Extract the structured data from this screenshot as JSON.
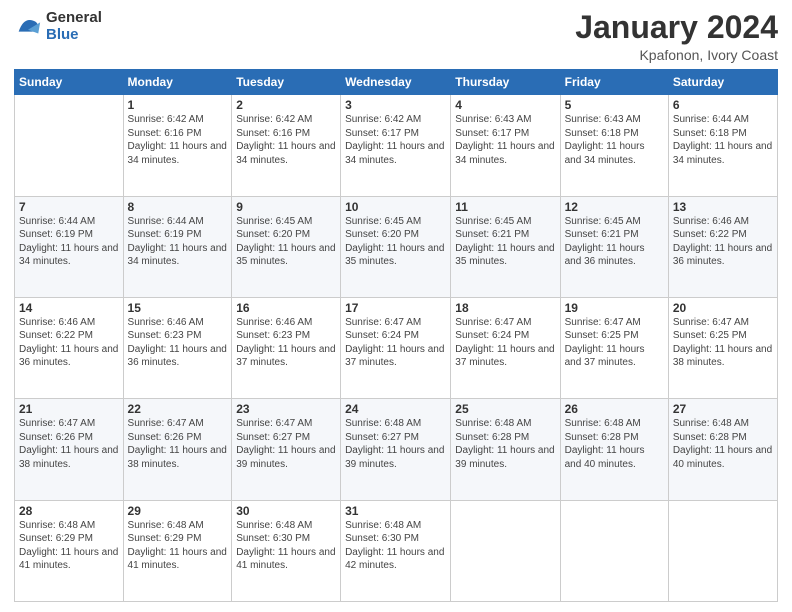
{
  "logo": {
    "general": "General",
    "blue": "Blue"
  },
  "header": {
    "title": "January 2024",
    "subtitle": "Kpafonon, Ivory Coast"
  },
  "days_of_week": [
    "Sunday",
    "Monday",
    "Tuesday",
    "Wednesday",
    "Thursday",
    "Friday",
    "Saturday"
  ],
  "weeks": [
    [
      {
        "day": "",
        "info": ""
      },
      {
        "day": "1",
        "info": "Sunrise: 6:42 AM\nSunset: 6:16 PM\nDaylight: 11 hours and 34 minutes."
      },
      {
        "day": "2",
        "info": "Sunrise: 6:42 AM\nSunset: 6:16 PM\nDaylight: 11 hours and 34 minutes."
      },
      {
        "day": "3",
        "info": "Sunrise: 6:42 AM\nSunset: 6:17 PM\nDaylight: 11 hours and 34 minutes."
      },
      {
        "day": "4",
        "info": "Sunrise: 6:43 AM\nSunset: 6:17 PM\nDaylight: 11 hours and 34 minutes."
      },
      {
        "day": "5",
        "info": "Sunrise: 6:43 AM\nSunset: 6:18 PM\nDaylight: 11 hours and 34 minutes."
      },
      {
        "day": "6",
        "info": "Sunrise: 6:44 AM\nSunset: 6:18 PM\nDaylight: 11 hours and 34 minutes."
      }
    ],
    [
      {
        "day": "7",
        "info": "Sunrise: 6:44 AM\nSunset: 6:19 PM\nDaylight: 11 hours and 34 minutes."
      },
      {
        "day": "8",
        "info": "Sunrise: 6:44 AM\nSunset: 6:19 PM\nDaylight: 11 hours and 34 minutes."
      },
      {
        "day": "9",
        "info": "Sunrise: 6:45 AM\nSunset: 6:20 PM\nDaylight: 11 hours and 35 minutes."
      },
      {
        "day": "10",
        "info": "Sunrise: 6:45 AM\nSunset: 6:20 PM\nDaylight: 11 hours and 35 minutes."
      },
      {
        "day": "11",
        "info": "Sunrise: 6:45 AM\nSunset: 6:21 PM\nDaylight: 11 hours and 35 minutes."
      },
      {
        "day": "12",
        "info": "Sunrise: 6:45 AM\nSunset: 6:21 PM\nDaylight: 11 hours and 36 minutes."
      },
      {
        "day": "13",
        "info": "Sunrise: 6:46 AM\nSunset: 6:22 PM\nDaylight: 11 hours and 36 minutes."
      }
    ],
    [
      {
        "day": "14",
        "info": "Sunrise: 6:46 AM\nSunset: 6:22 PM\nDaylight: 11 hours and 36 minutes."
      },
      {
        "day": "15",
        "info": "Sunrise: 6:46 AM\nSunset: 6:23 PM\nDaylight: 11 hours and 36 minutes."
      },
      {
        "day": "16",
        "info": "Sunrise: 6:46 AM\nSunset: 6:23 PM\nDaylight: 11 hours and 37 minutes."
      },
      {
        "day": "17",
        "info": "Sunrise: 6:47 AM\nSunset: 6:24 PM\nDaylight: 11 hours and 37 minutes."
      },
      {
        "day": "18",
        "info": "Sunrise: 6:47 AM\nSunset: 6:24 PM\nDaylight: 11 hours and 37 minutes."
      },
      {
        "day": "19",
        "info": "Sunrise: 6:47 AM\nSunset: 6:25 PM\nDaylight: 11 hours and 37 minutes."
      },
      {
        "day": "20",
        "info": "Sunrise: 6:47 AM\nSunset: 6:25 PM\nDaylight: 11 hours and 38 minutes."
      }
    ],
    [
      {
        "day": "21",
        "info": "Sunrise: 6:47 AM\nSunset: 6:26 PM\nDaylight: 11 hours and 38 minutes."
      },
      {
        "day": "22",
        "info": "Sunrise: 6:47 AM\nSunset: 6:26 PM\nDaylight: 11 hours and 38 minutes."
      },
      {
        "day": "23",
        "info": "Sunrise: 6:47 AM\nSunset: 6:27 PM\nDaylight: 11 hours and 39 minutes."
      },
      {
        "day": "24",
        "info": "Sunrise: 6:48 AM\nSunset: 6:27 PM\nDaylight: 11 hours and 39 minutes."
      },
      {
        "day": "25",
        "info": "Sunrise: 6:48 AM\nSunset: 6:28 PM\nDaylight: 11 hours and 39 minutes."
      },
      {
        "day": "26",
        "info": "Sunrise: 6:48 AM\nSunset: 6:28 PM\nDaylight: 11 hours and 40 minutes."
      },
      {
        "day": "27",
        "info": "Sunrise: 6:48 AM\nSunset: 6:28 PM\nDaylight: 11 hours and 40 minutes."
      }
    ],
    [
      {
        "day": "28",
        "info": "Sunrise: 6:48 AM\nSunset: 6:29 PM\nDaylight: 11 hours and 41 minutes."
      },
      {
        "day": "29",
        "info": "Sunrise: 6:48 AM\nSunset: 6:29 PM\nDaylight: 11 hours and 41 minutes."
      },
      {
        "day": "30",
        "info": "Sunrise: 6:48 AM\nSunset: 6:30 PM\nDaylight: 11 hours and 41 minutes."
      },
      {
        "day": "31",
        "info": "Sunrise: 6:48 AM\nSunset: 6:30 PM\nDaylight: 11 hours and 42 minutes."
      },
      {
        "day": "",
        "info": ""
      },
      {
        "day": "",
        "info": ""
      },
      {
        "day": "",
        "info": ""
      }
    ]
  ]
}
